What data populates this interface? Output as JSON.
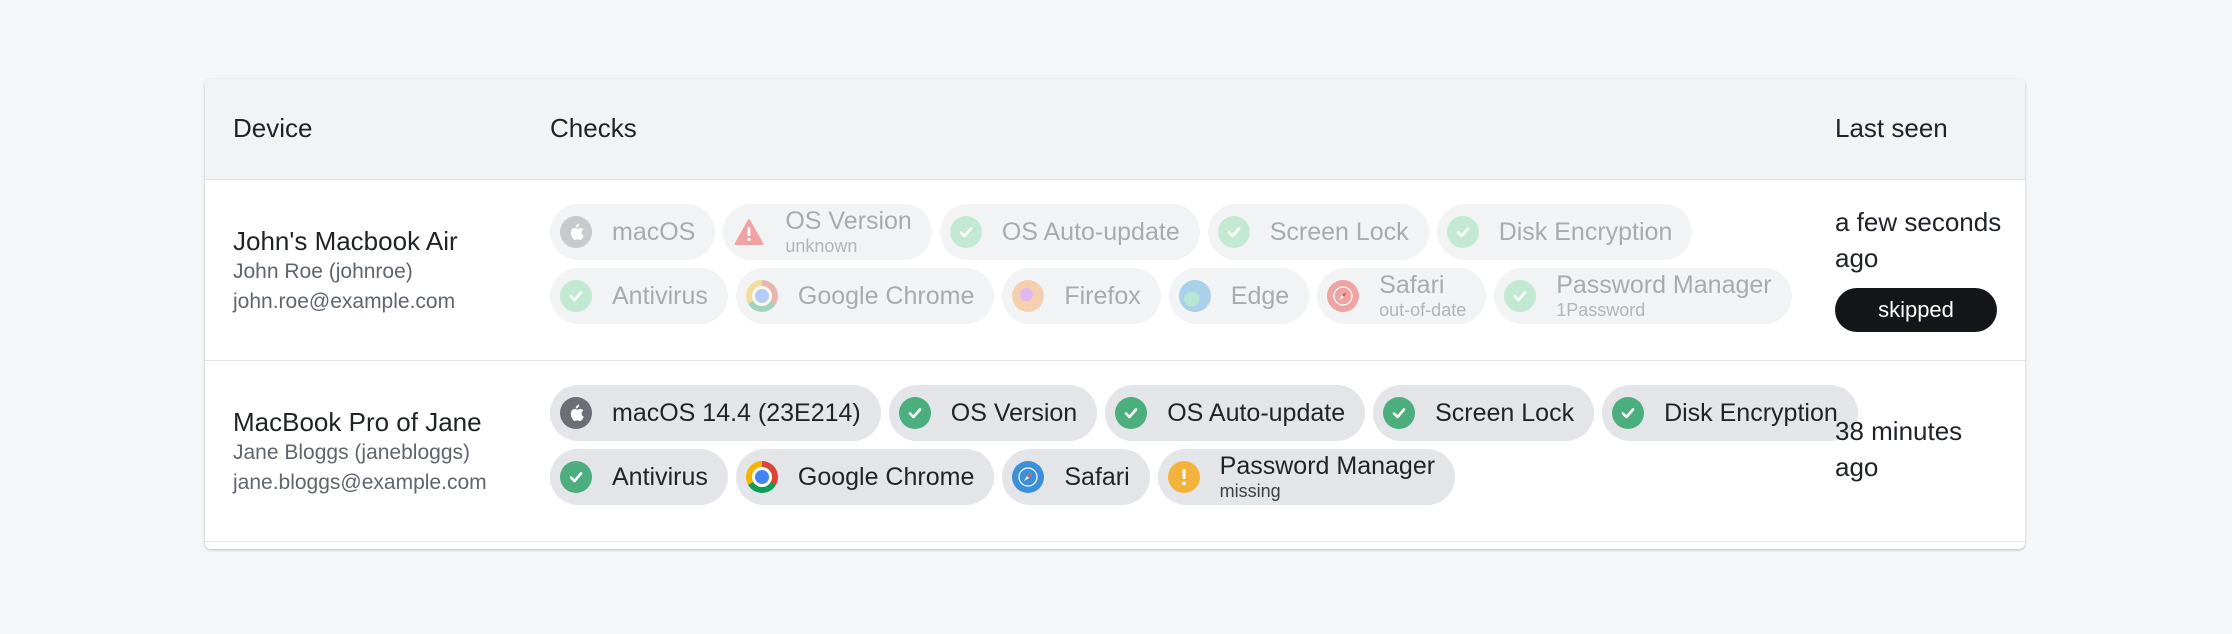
{
  "table": {
    "headers": {
      "device": "Device",
      "checks": "Checks",
      "last_seen": "Last seen"
    },
    "rows": [
      {
        "device_name": "John's Macbook Air",
        "owner": "John Roe (johnroe)",
        "email": "john.roe@example.com",
        "faded": true,
        "checks_line1": [
          {
            "label": "macOS",
            "icon": "apple-icon"
          },
          {
            "label": "OS Version",
            "sub": "unknown",
            "icon": "warning-icon"
          },
          {
            "label": "OS Auto-update",
            "icon": "check-icon"
          },
          {
            "label": "Screen Lock",
            "icon": "check-icon"
          },
          {
            "label": "Disk Encryption",
            "icon": "check-icon"
          }
        ],
        "checks_line2": [
          {
            "label": "Antivirus",
            "icon": "check-icon"
          },
          {
            "label": "Google Chrome",
            "icon": "chrome-icon"
          },
          {
            "label": "Firefox",
            "icon": "firefox-icon"
          },
          {
            "label": "Edge",
            "icon": "edge-icon"
          },
          {
            "label": "Safari",
            "sub": "out-of-date",
            "icon": "safari-icon"
          },
          {
            "label": "Password Manager",
            "sub": "1Password",
            "icon": "check-icon"
          }
        ],
        "last_seen": "a few seconds ago",
        "badge": "skipped"
      },
      {
        "device_name": "MacBook Pro of Jane",
        "owner": "Jane Bloggs (janebloggs)",
        "email": "jane.bloggs@example.com",
        "faded": false,
        "checks_line1": [
          {
            "label": "macOS 14.4 (23E214)",
            "icon": "apple-icon"
          },
          {
            "label": "OS Version",
            "icon": "check-icon"
          },
          {
            "label": "OS Auto-update",
            "icon": "check-icon"
          },
          {
            "label": "Screen Lock",
            "icon": "check-icon"
          },
          {
            "label": "Disk Encryption",
            "icon": "check-icon"
          }
        ],
        "checks_line2": [
          {
            "label": "Antivirus",
            "icon": "check-icon"
          },
          {
            "label": "Google Chrome",
            "icon": "chrome-icon"
          },
          {
            "label": "Safari",
            "icon": "safari-icon"
          },
          {
            "label": "Password Manager",
            "sub": "missing",
            "icon": "exclamation-icon"
          }
        ],
        "last_seen": "38 minutes ago"
      }
    ]
  },
  "colors": {
    "pass": "#4cae7d",
    "warning": "#f2b33d",
    "fail": "#f0a3a3",
    "badge_bg": "#14161a"
  }
}
